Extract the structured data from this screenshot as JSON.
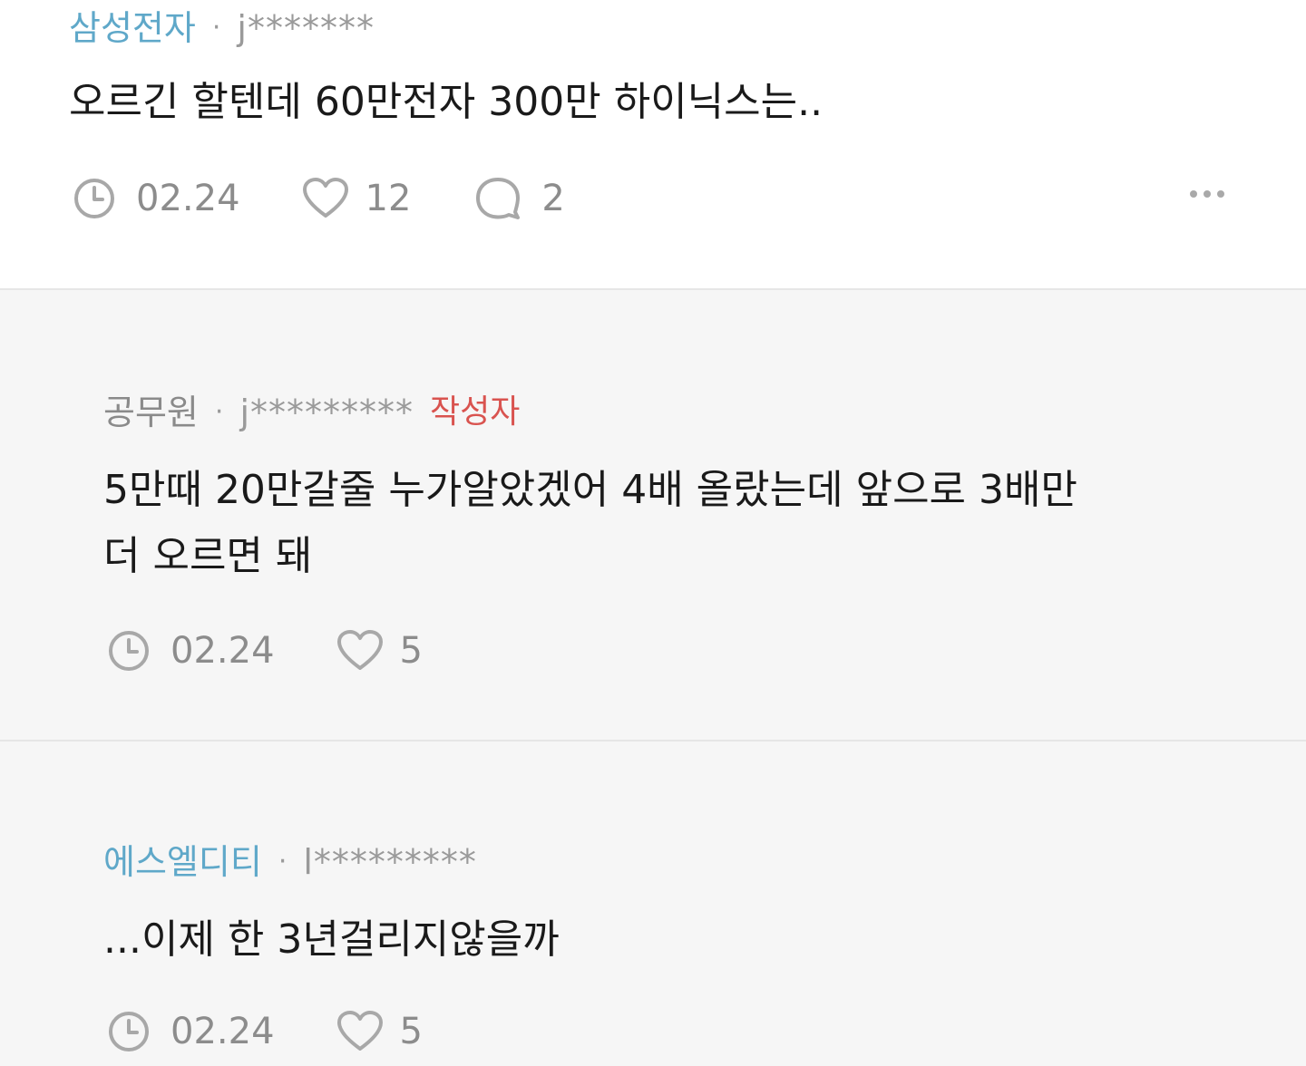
{
  "comments": [
    {
      "badge": "삼성전자",
      "separator": "·",
      "user": "j*******",
      "text": "오르긴 할텐데 60만전자 300만 하이닉스는..",
      "date": "02.24",
      "likes": "12",
      "replies": "2",
      "icons": [
        "clock-icon",
        "heart-icon",
        "speech-bubble-icon",
        "more-dots-icon"
      ]
    },
    {
      "badge": "공무원",
      "separator": "·",
      "user": "j*********",
      "author_tag": "작성자",
      "text_line1": "5만때 20만갈줄 누가알았겠어 4배 올랐는데 앞으로 3배만",
      "text_line2": "더 오르면 돼",
      "date": "02.24",
      "likes": "5",
      "icons": [
        "clock-icon",
        "heart-icon"
      ]
    },
    {
      "badge": "에스엘디티",
      "separator": "·",
      "user": "l*********",
      "text": "...이제 한 3년걸리지않을까",
      "date": "02.24",
      "likes": "5",
      "icons": [
        "clock-icon",
        "heart-icon"
      ]
    }
  ],
  "colors": {
    "badge_blue": "#5fa8c9",
    "badge_gray": "#8a8a8a",
    "author_tag": "#d9534f",
    "reply_background": "#f6f6f6",
    "divider": "#e6e6e6"
  }
}
